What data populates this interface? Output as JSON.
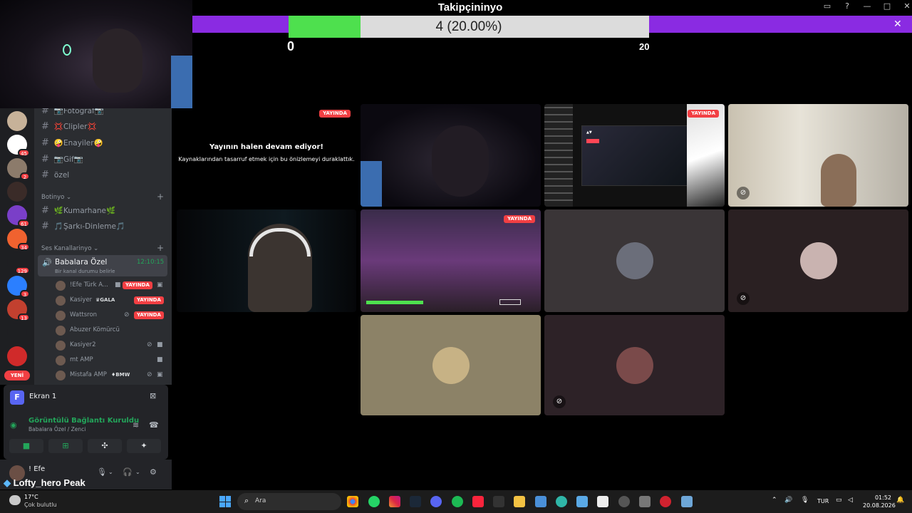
{
  "overlay": {
    "goal_title": "Takipçininyo",
    "goal_progress_text": "4 (20.00%)",
    "goal_min": "0",
    "goal_max": "20",
    "goal_fraction": 0.2,
    "streamer_tag": "Lofty_hero Peak"
  },
  "servers": [
    {
      "name": "server-1",
      "badge": "",
      "color": "#c7b299"
    },
    {
      "name": "server-2",
      "badge": "45",
      "color": "#ffffff"
    },
    {
      "name": "server-3",
      "badge": "2",
      "color": "#8c7b6b"
    },
    {
      "name": "server-4",
      "badge": "",
      "color": "#3a2b28"
    },
    {
      "name": "server-5",
      "badge": "61",
      "color": "#7a3fc8"
    },
    {
      "name": "server-6",
      "badge": "34",
      "color": "#f0622f"
    },
    {
      "name": "server-7",
      "badge": "129",
      "color": "#1e1f22"
    },
    {
      "name": "server-8",
      "badge": "3",
      "color": "#2b7fff"
    },
    {
      "name": "server-9",
      "badge": "13",
      "color": "#c2402f"
    },
    {
      "name": "server-10",
      "badge": "",
      "color": "#1e1f22"
    },
    {
      "name": "server-11",
      "badge": "",
      "color": "#d02a2a"
    }
  ],
  "servers_new_label": "YENİ",
  "channels": {
    "text": [
      "📷Fotoğraf📷",
      "💢Clipler💢",
      "🤪Enayiler🤪",
      "📷Gif📷",
      "özel"
    ],
    "cat_bot": "Botinyo",
    "bot_channels": [
      "🌿Kumarhane🌿",
      "🎵Şarkı-Dinleme🎵"
    ],
    "cat_voice": "Ses Kanallarinyo",
    "voice_channel": "Babalara Özel",
    "voice_time": "12:10:15",
    "voice_status": "Bir kanal durumu belirle",
    "users": [
      {
        "name": "!Efe Türk A...",
        "live": "YAYINDA"
      },
      {
        "name": "Kasiyer",
        "tag": "GALA",
        "live": "YAYINDA"
      },
      {
        "name": "Wattsron",
        "live": "YAYINDA"
      },
      {
        "name": "Abuzer Kömürcü"
      },
      {
        "name": "Kasiyer2"
      },
      {
        "name": "mt AMP"
      },
      {
        "name": "Mistafa AMP",
        "tag": "BMW"
      }
    ]
  },
  "panel": {
    "ekran_avatar": "F",
    "ekran_name": "Ekran 1",
    "conn_title": "Görüntülü Bağlantı Kuruldu",
    "conn_sub": "Babalara Özel / Zenci",
    "user_name": "! Efe"
  },
  "grid": {
    "live_label": "YAYINDA",
    "paused_title": "Yayının halen devam ediyor!",
    "paused_sub": "Kaynaklarından tasarruf etmek için bu önizlemeyi duraklattık."
  },
  "taskbar": {
    "temp": "17°C",
    "weather": "Çok bulutlu",
    "search": "Ara",
    "lang": "TUR",
    "time": "01:52",
    "date": "20.08.2026"
  },
  "colors": {
    "accent_purple": "#8a2be2",
    "progress_green": "#4ee04e",
    "live_red": "#f23f43",
    "voice_green": "#23a55a"
  }
}
